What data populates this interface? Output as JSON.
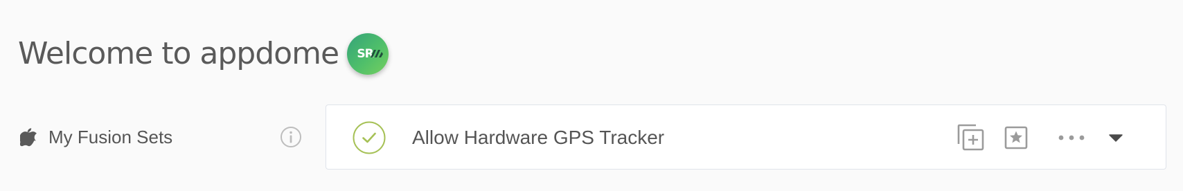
{
  "header": {
    "title": "Welcome to appdome",
    "avatar_initials": "SR"
  },
  "sidebar": {
    "platform_icon": "apple-icon",
    "label": "My Fusion Sets",
    "info_icon": "info-icon"
  },
  "fusion_set": {
    "title": "Allow Hardware GPS Tracker",
    "status_icon": "check-circle-icon",
    "actions": [
      "duplicate-icon",
      "favorite-star-icon",
      "more-options-icon",
      "expand-caret-icon"
    ]
  },
  "colors": {
    "check_green": "#a6c156",
    "avatar_green": "#4fbf6a",
    "icon_gray": "#9b9b9b",
    "text": "#555555"
  }
}
